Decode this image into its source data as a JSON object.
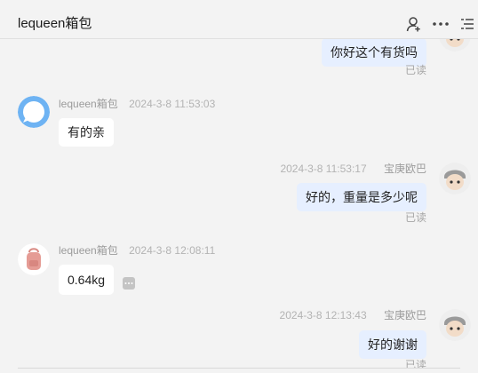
{
  "header": {
    "title": "lequeen箱包",
    "icons": [
      "user-add-icon",
      "more-icon",
      "list-icon"
    ]
  },
  "messages": [
    {
      "side": "out",
      "text": "你好这个有货吗",
      "status": "已读"
    },
    {
      "side": "in",
      "sender": "lequeen箱包",
      "time": "2024-3-8 11:53:03",
      "text": "有的亲"
    },
    {
      "side": "out",
      "sender": "宝庚欧巴",
      "time": "2024-3-8 11:53:17",
      "text": "好的，重量是多少呢",
      "status": "已读"
    },
    {
      "side": "in",
      "sender": "lequeen箱包",
      "time": "2024-3-8 12:08:11",
      "text": "0.64kg"
    },
    {
      "side": "out",
      "sender": "宝庚欧巴",
      "time": "2024-3-8 12:13:43",
      "text": "好的谢谢",
      "status": "已读"
    }
  ],
  "colors": {
    "background": "#f3f3f3",
    "bubble_in": "#ffffff",
    "bubble_out": "#e6efff",
    "meta_text": "#9b9b9b",
    "accent_avatar": "#6eb3f3"
  }
}
